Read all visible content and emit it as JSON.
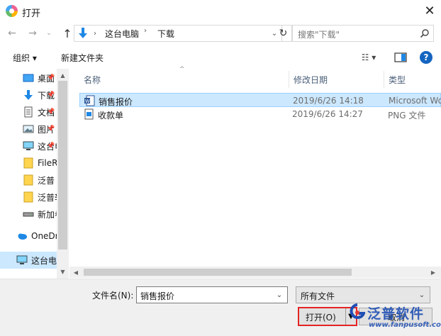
{
  "window": {
    "title": "打开",
    "close_glyph": "✕"
  },
  "address": {
    "back_glyph": "←",
    "forward_glyph": "→",
    "recent_glyph": "⌄",
    "up_glyph": "↑",
    "crumbs": [
      "这台电脑",
      "下载"
    ],
    "separator_glyph": "›",
    "dropdown_glyph": "⌄",
    "refresh_glyph": "↻"
  },
  "search": {
    "placeholder": "搜索\"下载\""
  },
  "toolbar": {
    "organize_label": "组织 ▾",
    "new_folder_label": "新建文件夹",
    "view_glyph": "☷ ▾",
    "help_glyph": "?"
  },
  "nav": {
    "items": [
      {
        "label": "桌面",
        "icon": "desktop-icon",
        "pinned": true
      },
      {
        "label": "下载",
        "icon": "download-icon",
        "pinned": true
      },
      {
        "label": "文档",
        "icon": "document-icon",
        "pinned": true
      },
      {
        "label": "图片",
        "icon": "picture-icon",
        "pinned": true
      },
      {
        "label": "这台电脑",
        "icon": "computer-icon",
        "pinned": true
      },
      {
        "label": "FileRecv",
        "icon": "folder-icon",
        "pinned": false
      },
      {
        "label": "泛普",
        "icon": "folder-icon",
        "pinned": false
      },
      {
        "label": "泛普软件",
        "icon": "folder-icon",
        "pinned": false
      },
      {
        "label": "新加卷",
        "icon": "drive-icon",
        "pinned": false
      },
      {
        "label": "OneDrive",
        "icon": "cloud-icon",
        "pinned": false
      },
      {
        "label": "这台电脑",
        "icon": "computer-icon",
        "pinned": false
      }
    ],
    "pin_glyph": "📌",
    "scroll_up_glyph": "▲",
    "scroll_down_glyph": "▼"
  },
  "list": {
    "sort_glyph": "^",
    "columns": {
      "name": "名称",
      "date": "修改日期",
      "type": "类型"
    },
    "rows": [
      {
        "name": "销售报价",
        "date": "2019/6/26 14:18",
        "type": "Microsoft Wo",
        "icon": "word-doc-icon",
        "selected": true
      },
      {
        "name": "收款单",
        "date": "2019/6/26 14:27",
        "type": "PNG 文件",
        "icon": "image-file-icon",
        "selected": false
      }
    ],
    "hscroll_left_glyph": "◀",
    "hscroll_right_glyph": "▶"
  },
  "bottom": {
    "filename_label": "文件名(N):",
    "filename_value": "销售报价",
    "filetype_value": "所有文件",
    "dropdown_glyph": "⌄",
    "open_label": "打开(O)",
    "open_split_glyph": "▼",
    "cancel_label": "取消"
  },
  "watermark": {
    "text": "泛普软件",
    "url": "www.fanpusoft.com"
  },
  "colors": {
    "accent": "#1565c0",
    "selection": "#cce8ff",
    "highlight_border": "#e52323",
    "watermark": "#1f4fb4"
  }
}
